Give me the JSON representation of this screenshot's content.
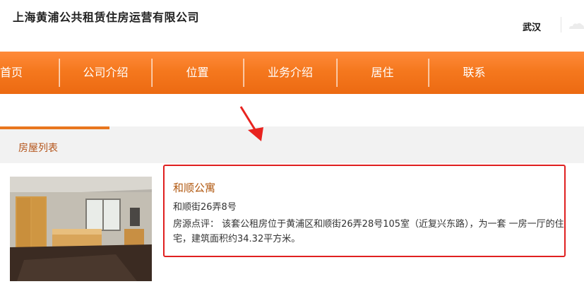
{
  "header": {
    "company_name": "上海黄浦公共租赁住房运营有限公司",
    "city": "武汉"
  },
  "nav": {
    "items": [
      {
        "label": "首页"
      },
      {
        "label": "公司介绍"
      },
      {
        "label": "位置"
      },
      {
        "label": "业务介绍"
      },
      {
        "label": "居住"
      },
      {
        "label": "联系"
      }
    ]
  },
  "section": {
    "title": "房屋列表"
  },
  "listing": {
    "name": "和顺公寓",
    "address": "和顺街26弄8号",
    "review": "房源点评： 该套公租房位于黄浦区和顺街26弄28号105室（近复兴东路），为一套 一房一厅的住宅，建筑面积约34.32平方米。"
  },
  "colors": {
    "nav_orange": "#f5781e",
    "accent_brown": "#b4541a",
    "highlight_red": "#e02020"
  }
}
